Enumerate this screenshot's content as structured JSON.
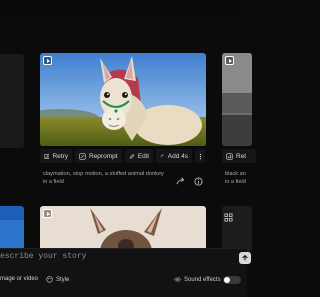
{
  "center_card": {
    "caption": "claymation, stop motion, a stuffed animal donkey in a field",
    "actions": {
      "retry": "Retry",
      "reprompt": "Reprompt",
      "edit": "Edit",
      "add": "Add 4s"
    }
  },
  "right_card": {
    "caption": "black an\nin a field",
    "action": "Ret"
  },
  "composer": {
    "placeholder": "escribe your story",
    "image_or_video": "mage or video",
    "style": "Style",
    "sound_effects": "Sound effects"
  },
  "colors": {
    "background": "#0b0b0c",
    "toolbar_button": "#161618",
    "footer": "#121214",
    "accent_blue": "#1b5fb8"
  }
}
